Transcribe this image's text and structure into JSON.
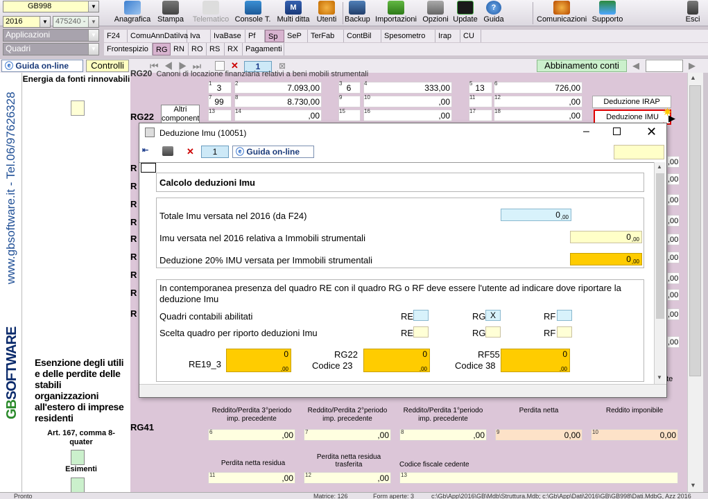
{
  "header": {
    "combo_code": "GB998",
    "combo_year": "2016",
    "combo_client": "475240 -",
    "combo_applicazioni": "Applicazioni",
    "combo_quadri": "Quadri"
  },
  "toolbar": {
    "anagrafica": "Anagrafica",
    "stampa": "Stampa",
    "telematico": "Telematico",
    "console": "Console T.",
    "multiditta": "Multi ditta",
    "utenti": "Utenti",
    "backup": "Backup",
    "importazioni": "Importazioni",
    "opzioni": "Opzioni",
    "update": "Update",
    "guida": "Guida",
    "comunicazioni": "Comunicazioni",
    "supporto": "Supporto",
    "esci": "Esci"
  },
  "tabs_row1": [
    "F24",
    "ComuAnnDatiIva",
    "Iva",
    "IvaBase",
    "Pf",
    "Sp",
    "SeP",
    "TerFab",
    "ContBil",
    "Spesometro",
    "Irap",
    "CU"
  ],
  "tabs_row2": [
    "Frontespizio",
    "RG",
    "RN",
    "RO",
    "RS",
    "RX",
    "Pagamenti"
  ],
  "navbar": {
    "guida_online": "Guida on-line",
    "controlli": "Controlli",
    "page": "1",
    "abbinamento": "Abbinamento conti"
  },
  "leftbar": {
    "brand": "SOFTWARE",
    "site": "www.gbsoftware.it - Tel.06/97626328"
  },
  "leftpanel": {
    "energia": "Energia da fonti rinnovabili",
    "esenzione": "Esenzione degli utili e delle perdite delle stabili organizzazioni all'estero di imprese residenti",
    "art": "Art. 167, comma 8-quater",
    "esimenti": "Esimenti"
  },
  "form": {
    "rg20_title": "Canoni di locazione finanziaria relativi a beni mobili strumentali",
    "rg20_label": "RG20",
    "rg22_label": "RG22",
    "altri_componenti": "Altri componenti",
    "deduzione_irap": "Deduzione IRAP",
    "deduzione_imu": "Deduzione IMU",
    "r1": [
      {
        "n": "1",
        "v": "3"
      },
      {
        "n": "2",
        "v": "7.093,00"
      },
      {
        "n": "3",
        "v": "6"
      },
      {
        "n": "4",
        "v": "333,00"
      },
      {
        "n": "5",
        "v": "13"
      },
      {
        "n": "6",
        "v": "726,00"
      }
    ],
    "r2": [
      {
        "n": "7",
        "v": "99"
      },
      {
        "n": "8",
        "v": "8.730,00"
      },
      {
        "n": "9",
        "v": ""
      },
      {
        "n": "10",
        "v": ",00"
      },
      {
        "n": "11",
        "v": ""
      },
      {
        "n": "12",
        "v": ",00"
      }
    ],
    "r3": [
      {
        "n": "13",
        "v": ""
      },
      {
        "n": "14",
        "v": ",00"
      },
      {
        "n": "15",
        "v": ""
      },
      {
        "n": "16",
        "v": ",00"
      },
      {
        "n": "17",
        "v": ""
      },
      {
        "n": "18",
        "v": ",00"
      }
    ],
    "rg41_label": "RG41",
    "rg41_cols": [
      "Reddito/Perdita 3°periodo imp. precedente",
      "Reddito/Perdita 2°periodo imp. precedente",
      "Reddito/Perdita 1°periodo imp. precedente",
      "Perdita netta",
      "Reddito imponibile"
    ],
    "rg41_vals": [
      {
        "n": "6",
        "v": ",00"
      },
      {
        "n": "7",
        "v": ",00"
      },
      {
        "n": "8",
        "v": ",00"
      },
      {
        "n": "9",
        "v": "0,00"
      },
      {
        "n": "10",
        "v": "0,00"
      }
    ],
    "perdita_residua": "Perdita netta residua",
    "perdita_trasferita": "Perdita netta residua trasferita",
    "codice_fiscale": "Codice fiscale cedente",
    "pnr_vals": [
      {
        "n": "11",
        "v": ",00"
      },
      {
        "n": "12",
        "v": ",00"
      },
      {
        "n": "13",
        "v": ""
      }
    ],
    "ente_label": "nte"
  },
  "dialog": {
    "title": "Deduzione Imu (10051)",
    "page": "1",
    "guida": "Guida on-line",
    "section_title": "Calcolo deduzioni Imu",
    "totale_label": "Totale Imu versata nel 2016 (da F24)",
    "totale_val": "0",
    "imu_strum_label": "Imu versata nel 2016 relativa a Immobili strumentali",
    "imu_strum_val": "0",
    "dedu_label": "Deduzione 20% IMU versata per Immobili strumentali",
    "dedu_val": "0",
    "cents": ",00",
    "info_text": "In contemporanea presenza del quadro RE con il quadro RG o RF deve essere l'utente ad indicare dove riportare la deduzione Imu",
    "quadri_label": "Quadri contabili abilitati",
    "scelta_label": "Scelta quadro per riporto deduzioni Imu",
    "re": "RE",
    "rg": "RG",
    "rf": "RF",
    "rg_checked": "X",
    "re19": "RE19_3",
    "rg22": "RG22",
    "codice23": "Codice 23",
    "rf55": "RF55",
    "codice38": "Codice 38",
    "zero": "0"
  },
  "status": {
    "left": "Pronto",
    "matrice": "Matrice: 126",
    "form": "Form aperte: 3",
    "path": "c:\\Gb\\App\\2016\\GB\\Mdb\\Struttura.Mdb; c:\\Gb\\App\\Dati\\2016\\GB\\GB998\\Dati.MdbG, Azz 2016"
  },
  "colors": {
    "accent": "#ffcc00",
    "highlight_red": "#e00000"
  }
}
